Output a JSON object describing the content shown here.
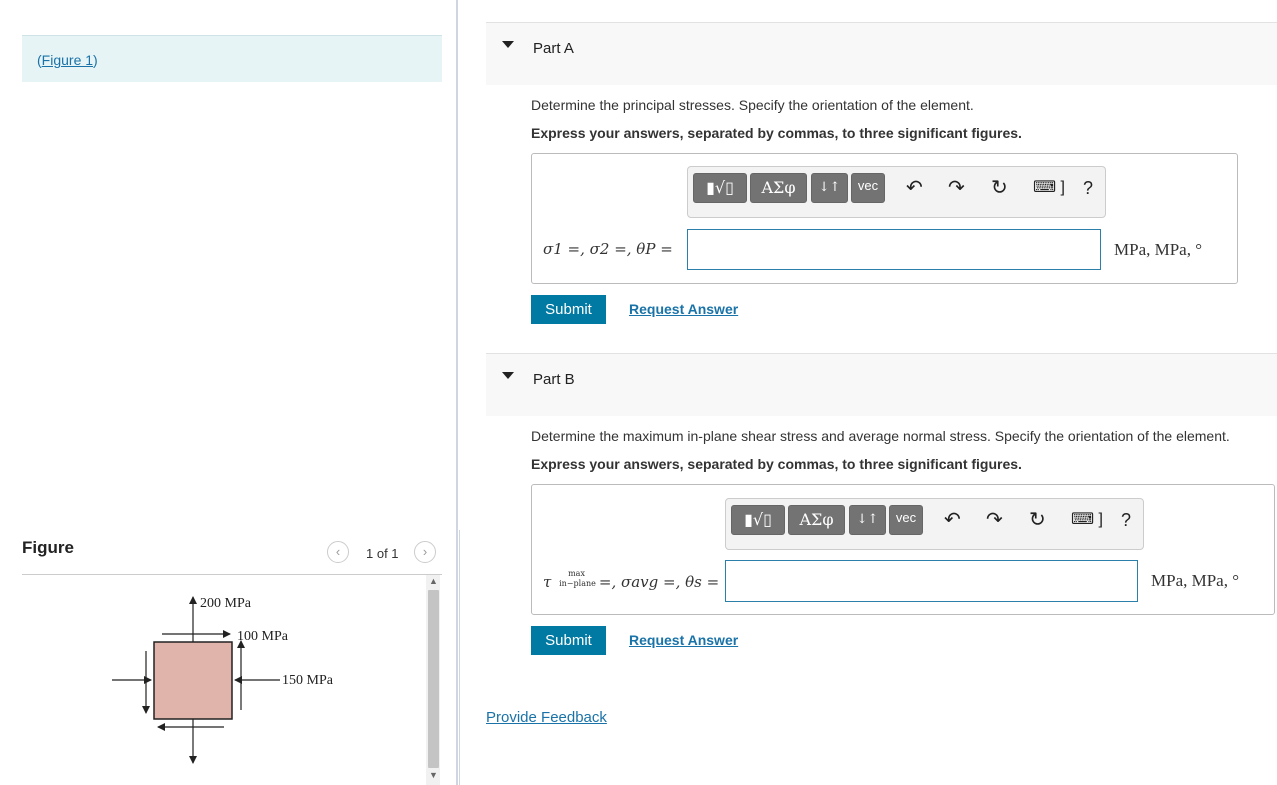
{
  "figure_link": {
    "prefix": "(",
    "text": "Figure 1",
    "suffix": ")"
  },
  "figure_panel": {
    "title": "Figure",
    "pager": {
      "prev": "‹",
      "count": "1 of 1",
      "next": "›"
    },
    "labels": {
      "top": "200 MPa",
      "shear": "100 MPa",
      "right": "150 MPa"
    },
    "colors": {
      "element_fill": "#e0b4aa"
    }
  },
  "parts": [
    {
      "title": "Part A",
      "question": "Determine the principal stresses. Specify the orientation of the element.",
      "instruction": "Express your answers, separated by commas, to three significant figures.",
      "toolbar": {
        "templates": "▮√▯",
        "greek": "ΑΣφ",
        "arrows": "↓↑",
        "vec": "vec",
        "undo": "↶",
        "redo": "↷",
        "reset": "↻",
        "keyboard": "⌨ ]",
        "help": "?"
      },
      "answer_label": "σ1 =, σ2 =, θP =",
      "input_value": "",
      "units": "MPa, MPa, °",
      "submit": "Submit",
      "request": "Request Answer"
    },
    {
      "title": "Part B",
      "question": "Determine the maximum in-plane shear stress and average normal stress. Specify the orientation of the element.",
      "instruction": "Express your answers, separated by commas, to three significant figures.",
      "toolbar": {
        "templates": "▮√▯",
        "greek": "ΑΣφ",
        "arrows": "↓↑",
        "vec": "vec",
        "undo": "↶",
        "redo": "↷",
        "reset": "↻",
        "keyboard": "⌨ ]",
        "help": "?"
      },
      "answer_label": {
        "tau": "τ",
        "max": "max",
        "inplane": "in−plane",
        "rest": "=, σavg =, θs ="
      },
      "input_value": "",
      "units": "MPa, MPa, °",
      "submit": "Submit",
      "request": "Request Answer"
    }
  ],
  "feedback": "Provide Feedback",
  "colors": {
    "accent": "#007aa3",
    "link": "#1a73a8",
    "figure_bg": "#e6f4f6"
  }
}
